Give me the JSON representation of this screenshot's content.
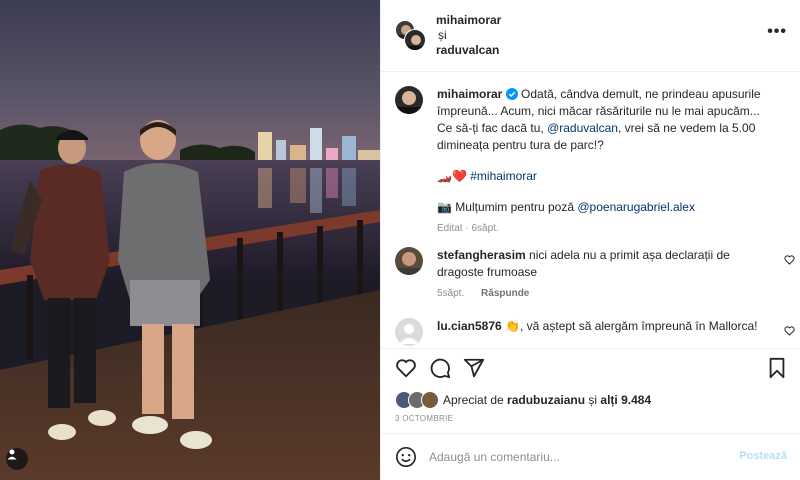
{
  "post": {
    "header": {
      "author": "mihaimorar",
      "conjunction": "și",
      "coauthor": "raduvalcan",
      "more_icon": "more-horizontal-icon"
    },
    "caption": {
      "author": "mihaimorar",
      "text_1": "Odată, cândva demult, ne prindeau apusurile împreună... Acum, nici măcar răsăriturile nu le mai apucăm... Ce să-ți fac dacă tu, ",
      "mention": "@raduvalcan",
      "text_2": ", vrei să ne vedem la 5.00 dimineața pentru tura de parc!?",
      "emojis": "🏎️❤️",
      "hashtag": "#mihaimorar",
      "photo_credit_emoji": "📷",
      "photo_credit_text": "Mulțumim pentru poză ",
      "photo_credit_mention": "@poenarugabriel.alex",
      "meta": "Editat · 6săpt."
    },
    "comments": [
      {
        "author": "stefangherasim",
        "text": "nici adela nu a primit așa declarații de dragoste frumoase",
        "time": "5săpt.",
        "reply_label": "Răspunde"
      },
      {
        "author": "lu.cian5876",
        "text": "👏, vă aștept să alergăm împreună în Mallorca!"
      }
    ],
    "likes": {
      "prefix": "Apreciat de ",
      "user": "radubuzaianu",
      "middle": " și ",
      "others": "alți 9.484"
    },
    "date": "3 OCTOMBRIE",
    "add_comment": {
      "placeholder": "Adaugă un comentariu...",
      "post_label": "Postează"
    }
  },
  "colors": {
    "link": "#00376b",
    "verified": "#0095f6",
    "post_disabled": "#b2dffc",
    "heart": "#ed4956"
  }
}
